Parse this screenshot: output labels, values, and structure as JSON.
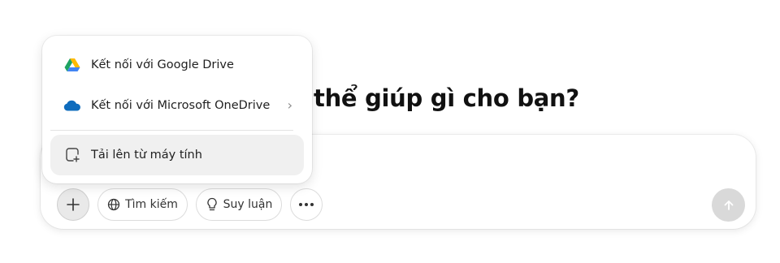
{
  "headline": "thể giúp gì cho bạn?",
  "menu": {
    "items": [
      {
        "label": "Kết nối với Google Drive",
        "icon": "google-drive-icon"
      },
      {
        "label": "Kết nối với Microsoft OneDrive",
        "icon": "onedrive-icon",
        "chevron": "›"
      },
      {
        "label": "Tải lên từ máy tính",
        "icon": "upload-file-icon"
      }
    ]
  },
  "toolbar": {
    "add_icon": "plus-icon",
    "search_label": "Tìm kiếm",
    "reason_label": "Suy luận",
    "more_icon": "more-icon",
    "send_icon": "arrow-up-icon"
  },
  "colors": {
    "drive_green": "#1ea362",
    "drive_yellow": "#ffba00",
    "drive_blue": "#4285f4",
    "onedrive_blue": "#0f6cbd",
    "send_disabled": "#d9d9d9"
  }
}
